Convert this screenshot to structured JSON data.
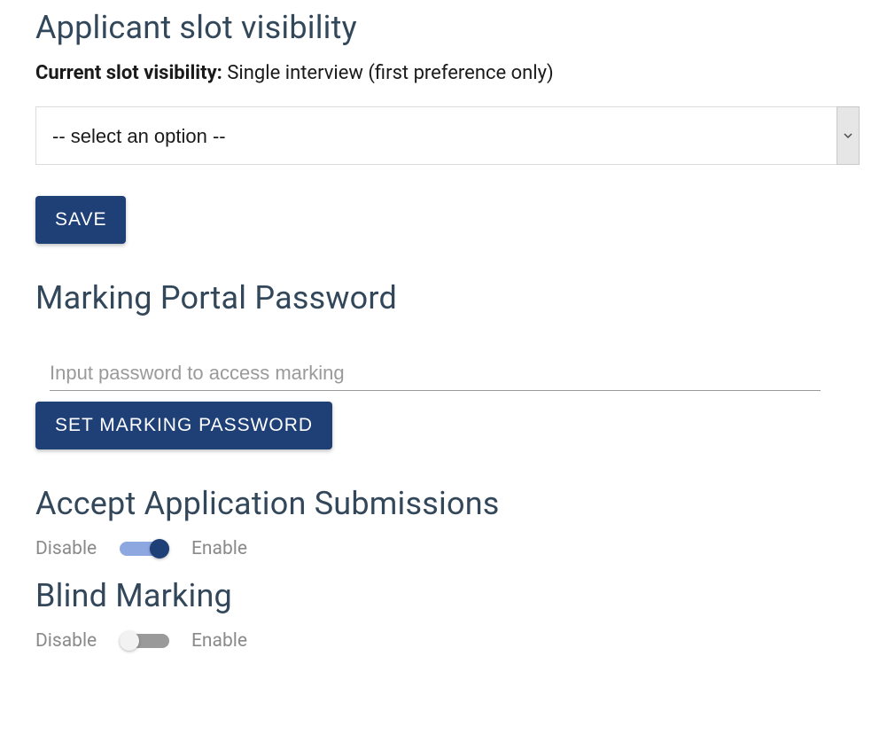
{
  "slot_visibility": {
    "heading": "Applicant slot visibility",
    "current_label": "Current slot visibility:",
    "current_value": "Single interview (first preference only)",
    "select_placeholder": "-- select an option --",
    "save_button": "SAVE"
  },
  "marking_password": {
    "heading": "Marking Portal Password",
    "placeholder": "Input password to access marking",
    "value": "",
    "set_button": "SET MARKING PASSWORD"
  },
  "accept_submissions": {
    "heading": "Accept Application Submissions",
    "disable_label": "Disable",
    "enable_label": "Enable",
    "enabled": true
  },
  "blind_marking": {
    "heading": "Blind Marking",
    "disable_label": "Disable",
    "enable_label": "Enable",
    "enabled": false
  }
}
